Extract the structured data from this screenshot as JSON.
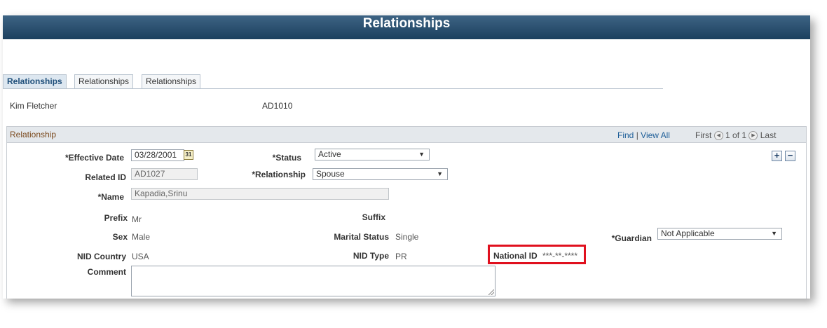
{
  "page": {
    "title": "Relationships"
  },
  "tabs": [
    {
      "label": "Relationships",
      "active": true
    },
    {
      "label": "Relationships",
      "active": false
    },
    {
      "label": "Relationships",
      "active": false
    }
  ],
  "person": {
    "name": "Kim Fletcher",
    "id": "AD1010"
  },
  "section": {
    "title": "Relationship",
    "nav": {
      "find": "Find",
      "separator": "|",
      "view_all": "View All",
      "first": "First",
      "count": "1 of 1",
      "last": "Last"
    }
  },
  "fields": {
    "effective_date": {
      "label": "*Effective Date",
      "value": "03/28/2001"
    },
    "status": {
      "label": "*Status",
      "value": "Active"
    },
    "related_id": {
      "label": "Related ID",
      "value": "AD1027"
    },
    "relationship": {
      "label": "*Relationship",
      "value": "Spouse"
    },
    "name": {
      "label": "*Name",
      "value": "Kapadia,Srinu"
    },
    "prefix": {
      "label": "Prefix",
      "value": "Mr"
    },
    "suffix": {
      "label": "Suffix",
      "value": ""
    },
    "sex": {
      "label": "Sex",
      "value": "Male"
    },
    "marital_status": {
      "label": "Marital Status",
      "value": "Single"
    },
    "guardian": {
      "label": "*Guardian",
      "value": "Not Applicable"
    },
    "nid_country": {
      "label": "NID Country",
      "value": "USA"
    },
    "nid_type": {
      "label": "NID Type",
      "value": "PR"
    },
    "national_id": {
      "label": "National ID",
      "value": "***-**-****"
    },
    "comment": {
      "label": "Comment",
      "value": ""
    }
  },
  "icons": {
    "calendar": "31",
    "add": "+",
    "delete": "−",
    "caret": "▼",
    "prev": "◀",
    "next": "▶"
  },
  "colors": {
    "header": "#1b3f5e",
    "highlight": "#e0101e",
    "section_title": "#7b4a1e"
  }
}
